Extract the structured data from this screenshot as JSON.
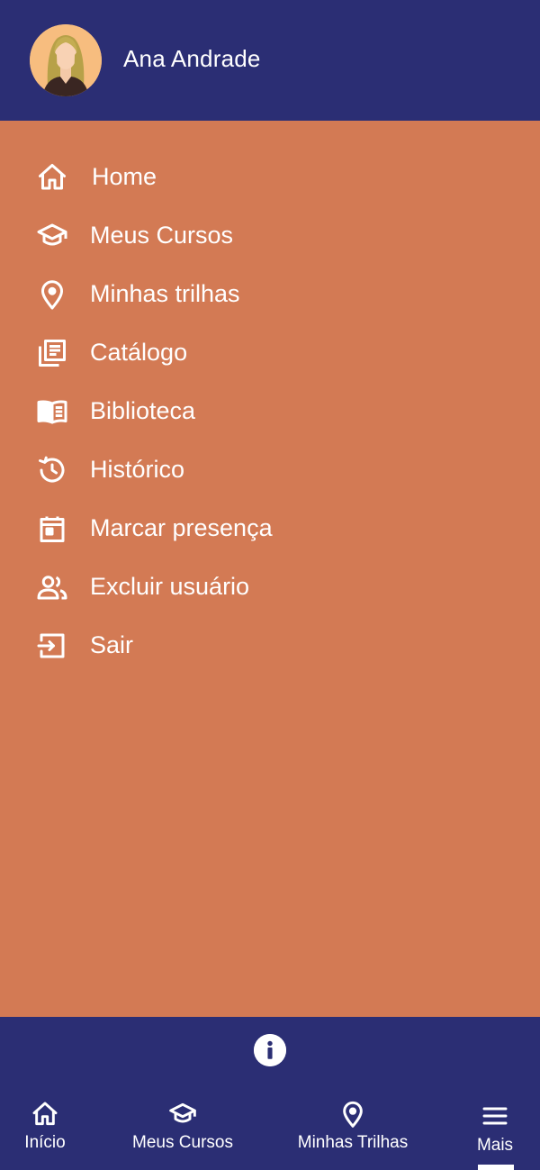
{
  "header": {
    "user_name": "Ana Andrade",
    "avatar_icon": "woman-avatar-icon"
  },
  "menu": {
    "items": [
      {
        "label": "Home",
        "icon": "home-icon"
      },
      {
        "label": "Meus Cursos",
        "icon": "graduation-cap-icon"
      },
      {
        "label": "Minhas trilhas",
        "icon": "map-pin-icon"
      },
      {
        "label": "Catálogo",
        "icon": "catalog-icon"
      },
      {
        "label": "Biblioteca",
        "icon": "open-book-icon"
      },
      {
        "label": "Histórico",
        "icon": "history-icon"
      },
      {
        "label": "Marcar presença",
        "icon": "calendar-icon"
      },
      {
        "label": "Excluir usuário",
        "icon": "users-icon"
      },
      {
        "label": "Sair",
        "icon": "logout-icon"
      }
    ]
  },
  "footer": {
    "info_icon": "info-icon",
    "nav": [
      {
        "label": "Início",
        "icon": "home-icon"
      },
      {
        "label": "Meus Cursos",
        "icon": "graduation-cap-icon"
      },
      {
        "label": "Minhas Trilhas",
        "icon": "map-pin-icon"
      },
      {
        "label": "Mais",
        "icon": "menu-icon",
        "active": true
      }
    ]
  },
  "colors": {
    "header_bg": "#2b2e74",
    "menu_bg": "#d37a54",
    "text": "#ffffff",
    "avatar_bg": "#f7bd7f"
  }
}
